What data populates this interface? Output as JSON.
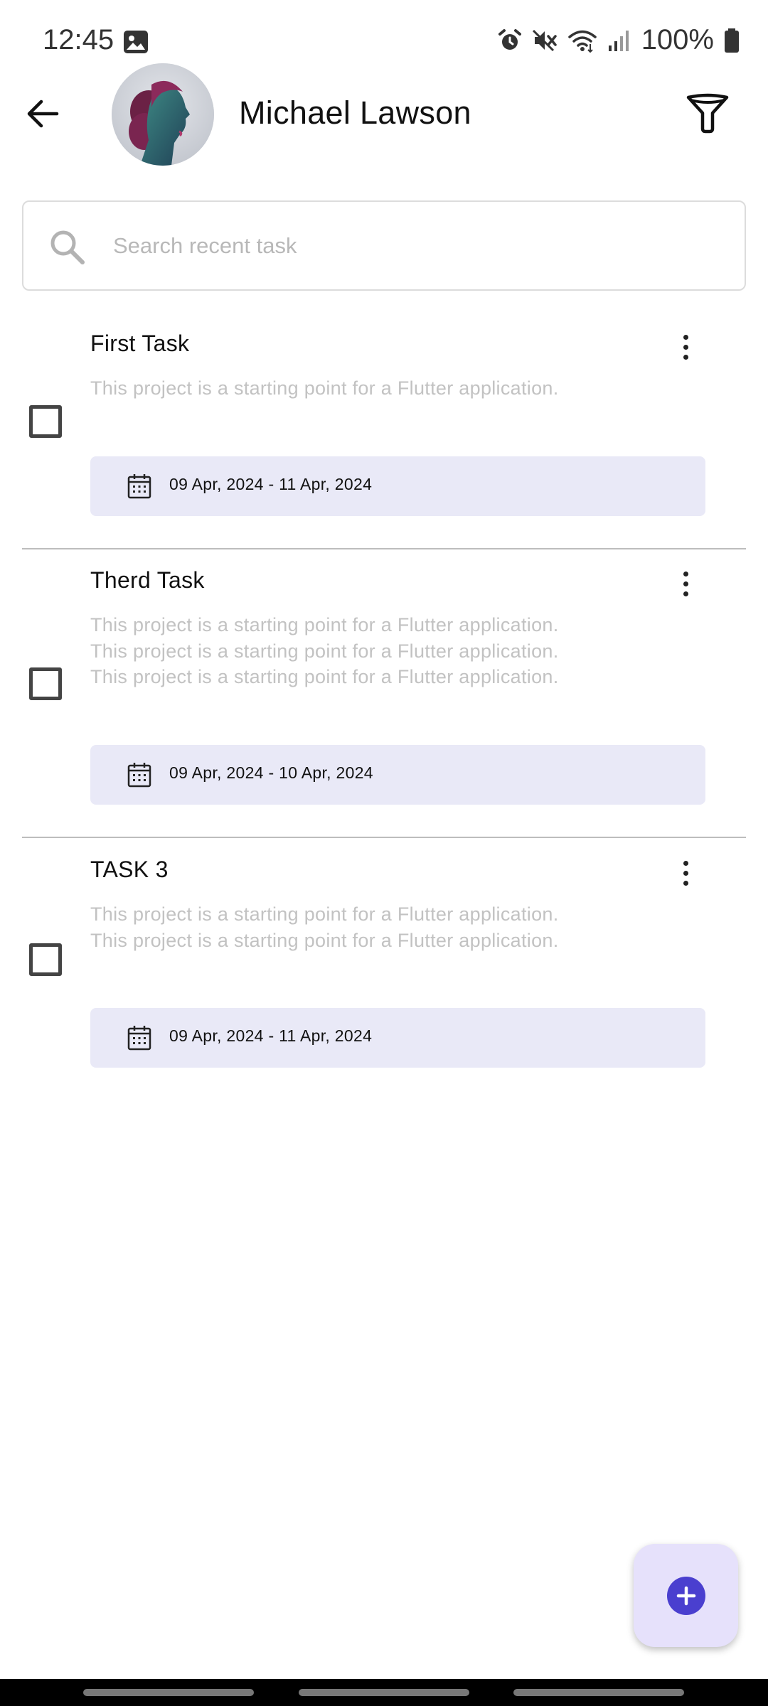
{
  "status_bar": {
    "time": "12:45",
    "battery": "100%",
    "icons": [
      "gallery-icon",
      "alarm-icon",
      "mute-icon",
      "wifi-icon",
      "signal-icon",
      "battery-icon"
    ]
  },
  "header": {
    "user_name": "Michael Lawson",
    "back_icon": "arrow-left-icon",
    "filter_icon": "filter-icon"
  },
  "search": {
    "placeholder": "Search recent task",
    "value": ""
  },
  "tasks": [
    {
      "title": "First Task",
      "description": "This project is a starting point for a Flutter application.",
      "date_range": "09 Apr, 2024 - 11 Apr, 2024",
      "completed": false
    },
    {
      "title": "Therd Task",
      "description": "This project is a starting point for a Flutter application.\nThis project is a starting point for a Flutter application.\nThis project is a starting point for a Flutter application.",
      "date_range": "09 Apr, 2024 - 10 Apr, 2024",
      "completed": false
    },
    {
      "title": "TASK 3",
      "description": "This project is a starting point for a Flutter application.\nThis project is a starting point for a Flutter application.",
      "date_range": "09 Apr, 2024 - 11 Apr, 2024",
      "completed": false
    }
  ],
  "fab": {
    "icon": "plus-icon"
  },
  "colors": {
    "accent": "#4a3fcf",
    "chip_bg": "#e9e9f7",
    "fab_bg": "#e6e1fb",
    "muted_text": "#c2c2c2"
  }
}
